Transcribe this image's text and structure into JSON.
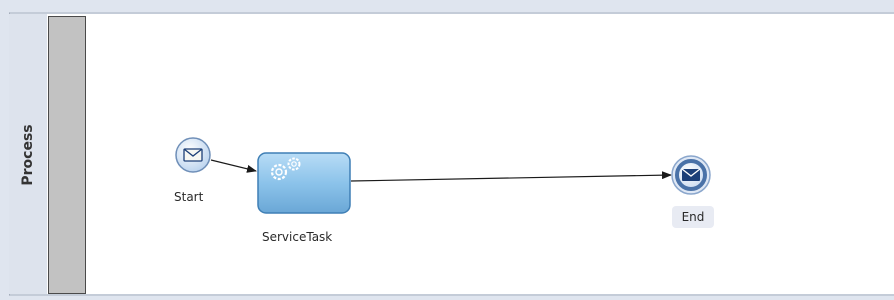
{
  "lane": {
    "title": "Process"
  },
  "nodes": {
    "start": {
      "label": "Start",
      "type": "message-start-event",
      "icon": "envelope-icon"
    },
    "service_task": {
      "label": "ServiceTask",
      "type": "service-task",
      "icon": "gears-icon"
    },
    "end": {
      "label": "End",
      "type": "message-end-event",
      "icon": "envelope-icon"
    }
  },
  "flows": [
    {
      "from": "Start",
      "to": "ServiceTask"
    },
    {
      "from": "ServiceTask",
      "to": "End"
    }
  ],
  "colors": {
    "task_fill": "#8cc3ea",
    "task_stroke": "#3f7fb5",
    "event_fill": "#c9dcf2",
    "event_stroke": "#5b7fa8",
    "end_ring": "#4a72a8",
    "envelope_dark": "#1c3f78",
    "lane_grip": "#c2c2c2"
  }
}
